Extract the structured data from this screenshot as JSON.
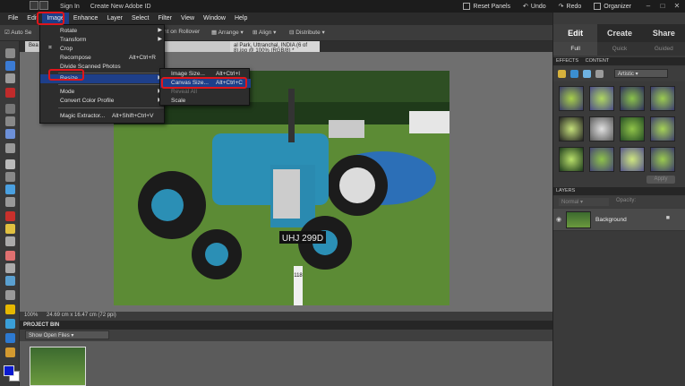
{
  "titlebar": {
    "sign_in": "Sign In",
    "create_id": "Create New Adobe ID",
    "reset_panels": "Reset Panels",
    "undo": "Undo",
    "redo": "Redo",
    "organizer": "Organizer"
  },
  "menubar": [
    "File",
    "Edit",
    "Image",
    "Enhance",
    "Layer",
    "Select",
    "Filter",
    "View",
    "Window",
    "Help"
  ],
  "options_bar": {
    "auto_select": "Auto Se",
    "highlight_rollover": "ight on Rollover",
    "arrange": "Arrange",
    "align": "Align",
    "distribute": "Distribute"
  },
  "tabs": {
    "doc1": "Bea",
    "doc2": "al Park, Uttranchal, INDIA (6 of 8).jpg @ 100% (RGB/8) *"
  },
  "image_menu": {
    "items": [
      {
        "label": "Rotate",
        "shortcut": "",
        "submenu": true
      },
      {
        "label": "Transform",
        "shortcut": "",
        "submenu": true
      },
      {
        "label": "Crop",
        "shortcut": "",
        "submenu": false
      },
      {
        "label": "Recompose",
        "shortcut": "Alt+Ctrl+R",
        "submenu": false
      },
      {
        "label": "Divide Scanned Photos",
        "shortcut": "",
        "submenu": false
      },
      {
        "label": "Resize",
        "shortcut": "",
        "submenu": true
      },
      {
        "label": "Mode",
        "shortcut": "",
        "submenu": true
      },
      {
        "label": "Convert Color Profile",
        "shortcut": "",
        "submenu": true
      },
      {
        "label": "Magic Extractor...",
        "shortcut": "Alt+Shift+Ctrl+V",
        "submenu": false
      }
    ]
  },
  "resize_submenu": {
    "items": [
      {
        "label": "Image Size...",
        "shortcut": "Alt+Ctrl+I",
        "disabled": false
      },
      {
        "label": "Canvas Size...",
        "shortcut": "Alt+Ctrl+C",
        "disabled": false
      },
      {
        "label": "Reveal All",
        "shortcut": "",
        "disabled": true
      },
      {
        "label": "Scale",
        "shortcut": "",
        "disabled": false
      }
    ]
  },
  "status": {
    "zoom": "100%",
    "doc_size": "24.69 cm x 16.47 cm (72 ppi)"
  },
  "project_bin": {
    "title": "PROJECT BIN",
    "filter": "Show Open Files"
  },
  "panel": {
    "tabs": [
      "Edit",
      "Create",
      "Share"
    ],
    "subtabs": [
      "Full",
      "Quick",
      "Guided"
    ],
    "effects_head": "EFFECTS",
    "content_head": "CONTENT",
    "effects_filter": "Artistic",
    "apply_label": "Apply",
    "layers_head": "LAYERS",
    "blend_mode": "Normal",
    "opacity_label": "Opacity:",
    "layer_name": "Background"
  },
  "photo": {
    "plate": "UHJ 299D",
    "tag": "118"
  },
  "colors": {
    "accent": "#1e3f8a",
    "highlight_box": "#e0151b",
    "foreground": "#0a1ad0",
    "background": "#ffffff"
  }
}
